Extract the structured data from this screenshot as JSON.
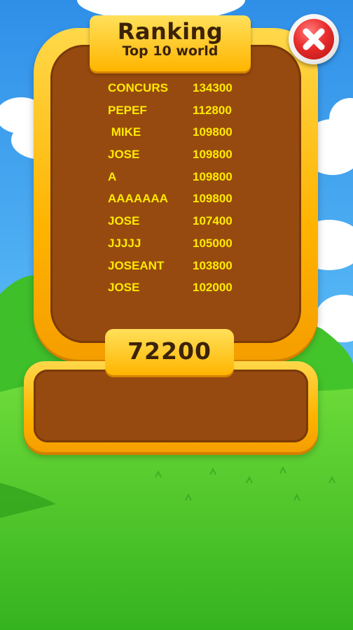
{
  "header": {
    "title": "Ranking",
    "subtitle": "Top 10 world"
  },
  "close_button": {
    "icon": "close-icon"
  },
  "rankings": [
    {
      "name": "CONCURS",
      "score": "134300"
    },
    {
      "name": "PEPEF",
      "score": "112800"
    },
    {
      "name": " MIKE",
      "score": "109800"
    },
    {
      "name": "JOSE",
      "score": "109800"
    },
    {
      "name": "A",
      "score": "109800"
    },
    {
      "name": "AAAAAAA",
      "score": "109800"
    },
    {
      "name": "JOSE",
      "score": "107400"
    },
    {
      "name": "JJJJJ",
      "score": "105000"
    },
    {
      "name": "JOSEANT",
      "score": "103800"
    },
    {
      "name": "JOSE",
      "score": "102000"
    }
  ],
  "player_score": "72200",
  "colors": {
    "panel_gold": "#ffb300",
    "panel_brown": "#974a0f",
    "list_text": "#ffea00",
    "title_text": "#3b2208",
    "close_red": "#ea2d2d",
    "sky": "#3aa6f2",
    "grass": "#4ccb2c"
  }
}
